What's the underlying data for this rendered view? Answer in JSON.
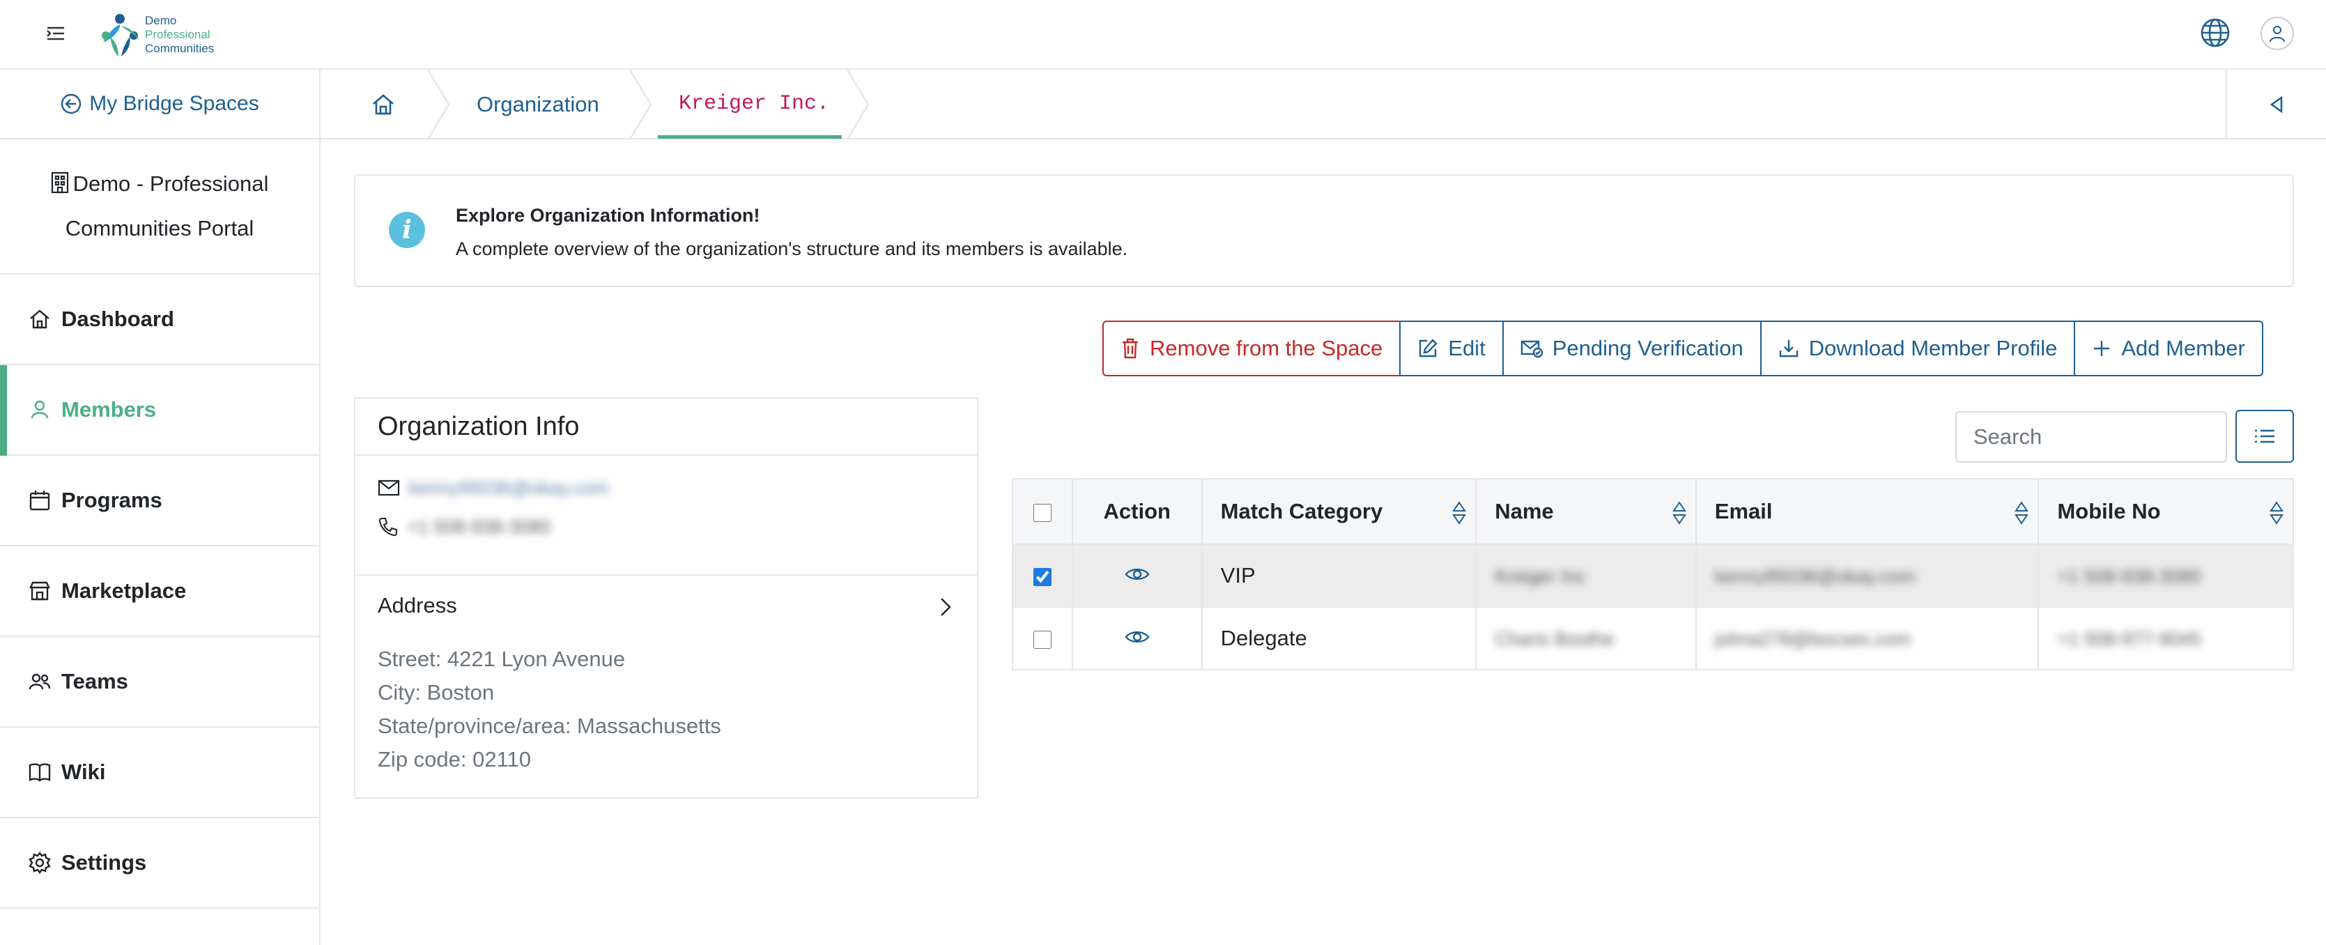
{
  "header": {
    "logo_lines": [
      "Demo",
      "Professional",
      "Communities"
    ]
  },
  "sidebar": {
    "back_label": "My Bridge Spaces",
    "portal_name": "Demo - Professional Communities Portal",
    "items": [
      {
        "label": "Dashboard",
        "icon": "home-icon"
      },
      {
        "label": "Members",
        "icon": "user-icon",
        "active": true
      },
      {
        "label": "Programs",
        "icon": "calendar-icon"
      },
      {
        "label": "Marketplace",
        "icon": "store-icon"
      },
      {
        "label": "Teams",
        "icon": "team-icon"
      },
      {
        "label": "Wiki",
        "icon": "book-icon"
      },
      {
        "label": "Settings",
        "icon": "gear-icon"
      }
    ]
  },
  "breadcrumb": {
    "items": [
      "Organization",
      "Kreiger Inc."
    ]
  },
  "alert": {
    "title": "Explore Organization Information!",
    "text": "A complete overview of the organization's structure and its members is available."
  },
  "actions": {
    "remove": "Remove from the Space",
    "edit": "Edit",
    "pending": "Pending Verification",
    "download": "Download Member Profile",
    "add": "Add Member"
  },
  "org_info": {
    "title": "Organization Info",
    "email": "kenny95036@okay.com",
    "phone": "+1 508-938-3080",
    "address_label": "Address",
    "street": "Street: 4221 Lyon Avenue",
    "city": "City: Boston",
    "state": "State/province/area: Massachusetts",
    "zip": "Zip code: 02110"
  },
  "table": {
    "search_placeholder": "Search",
    "columns": [
      "Action",
      "Match Category",
      "Name",
      "Email",
      "Mobile No"
    ],
    "rows": [
      {
        "checked": true,
        "category": "VIP",
        "name": "Kreiger Inc",
        "email": "kenny95036@okay.com",
        "mobile": "+1 508-938-3080"
      },
      {
        "checked": false,
        "category": "Delegate",
        "name": "Charis Boothe",
        "email": "jolma278@bocses.com",
        "mobile": "+1 508-977-9045"
      }
    ]
  },
  "colors": {
    "primary": "#1f5f8f",
    "accent": "#4caf84",
    "danger": "#c62828",
    "crumb_current": "#c2185b",
    "info": "#5bc0de"
  }
}
